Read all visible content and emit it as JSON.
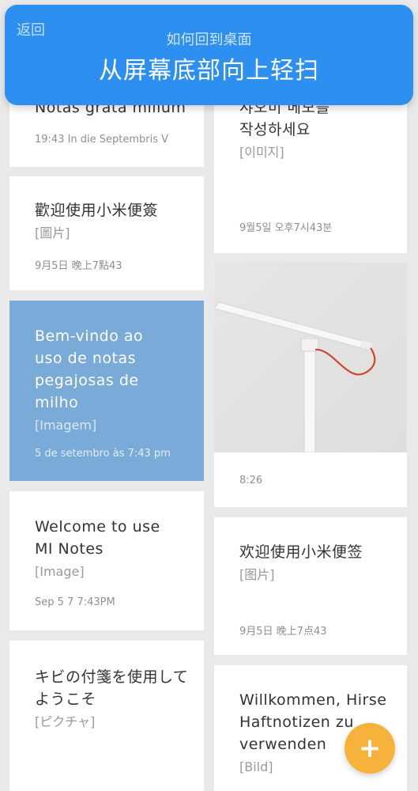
{
  "banner": {
    "back_label": "返回",
    "subtitle": "如何回到桌面",
    "title": "从屏幕底部向上轻扫"
  },
  "left_notes": [
    {
      "title": "Notas grata milium",
      "attachment": "",
      "time": "19:43 In die Septembris V"
    },
    {
      "title": "歡迎使用小米便簽",
      "attachment": "[圖片]",
      "time": "9月5日 晚上7點43"
    },
    {
      "title": "Bem-vindo ao\nuso de notas\npegajosas de\nmilho",
      "attachment": "[Imagem]",
      "time": "5 de setembro às 7:43 pm"
    },
    {
      "title": "Welcome to use\nMI Notes",
      "attachment": "[Image]",
      "time": "Sep 5 7 7:43PM"
    },
    {
      "title": "キビの付箋を使用して\nようこそ",
      "attachment": "[ピクチャ]",
      "time": ""
    }
  ],
  "right_notes": [
    {
      "title": "샤오미 메모를\n작성하세요",
      "attachment": "[이미지]",
      "time": "9월5일 오후7시43분"
    },
    {
      "title": "",
      "attachment": "",
      "time": "8:26"
    },
    {
      "title": "欢迎使用小米便签",
      "attachment": "[图片]",
      "time": "9月5日 晚上7点43"
    },
    {
      "title": "Willkommen, Hirse\nHaftnotizen zu\nverwenden",
      "attachment": "[Bild]",
      "time": ""
    }
  ],
  "fab": {
    "label": "+",
    "icon": "plus-icon",
    "color": "#f6b23a"
  },
  "colors": {
    "banner": "#2d8ff0",
    "selected_card": "#7aaad8",
    "background": "#e9e9e9"
  }
}
